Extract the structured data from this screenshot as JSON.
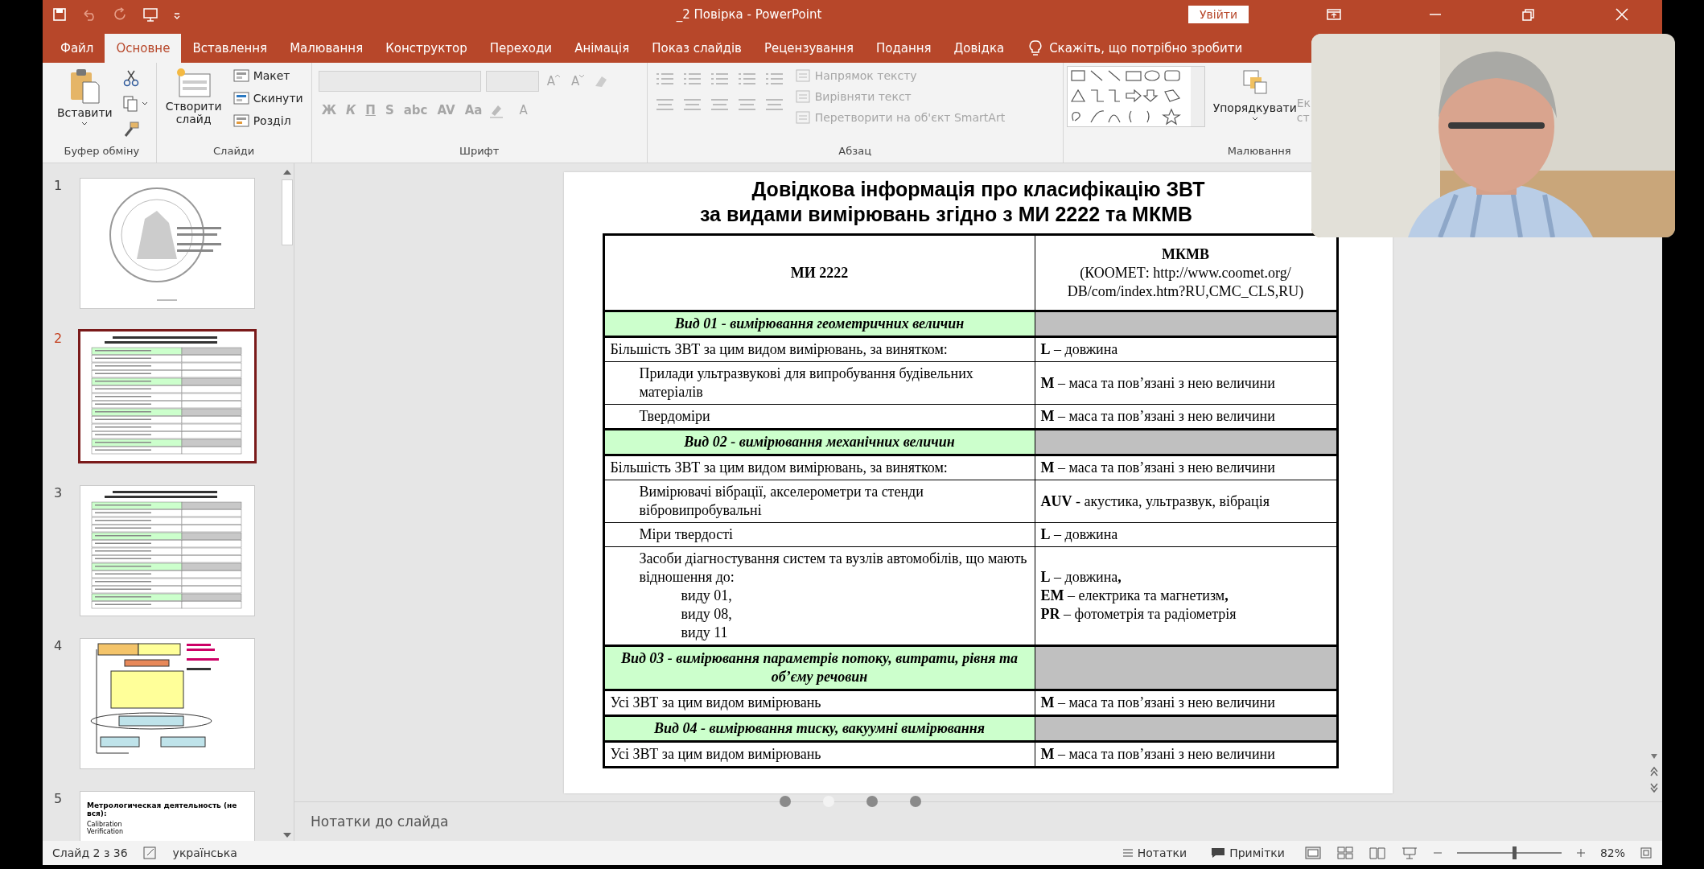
{
  "window": {
    "title": "_2 Повірка  -  PowerPoint",
    "sign_in": "Увійти"
  },
  "ribbon_tabs": [
    {
      "label": "Файл",
      "selected": false
    },
    {
      "label": "Основне",
      "selected": true
    },
    {
      "label": "Вставлення",
      "selected": false
    },
    {
      "label": "Малювання",
      "selected": false
    },
    {
      "label": "Конструктор",
      "selected": false
    },
    {
      "label": "Переходи",
      "selected": false
    },
    {
      "label": "Анімація",
      "selected": false
    },
    {
      "label": "Показ слайдів",
      "selected": false
    },
    {
      "label": "Рецензування",
      "selected": false
    },
    {
      "label": "Подання",
      "selected": false
    },
    {
      "label": "Довідка",
      "selected": false
    }
  ],
  "tell_me": "Скажіть, що потрібно зробити",
  "clipboard": {
    "paste": "Вставити",
    "label": "Буфер обміну"
  },
  "slides_group": {
    "new_slide": "Створити слайд",
    "items": [
      "Макет",
      "Скинути",
      "Розділ"
    ],
    "label": "Слайди"
  },
  "font": {
    "disabled": true,
    "row1": [
      {
        "kind": "grow",
        "text": "A"
      },
      {
        "kind": "shrink",
        "text": "A"
      }
    ],
    "row2": [
      "Ж",
      "К",
      "П",
      "S",
      "abc",
      "AV",
      "Aa"
    ],
    "color_button": "A",
    "label": "Шрифт"
  },
  "paragraph": {
    "commands": [
      {
        "label": "Напрямок тексту",
        "disabled": true
      },
      {
        "label": "Вирівняти текст",
        "disabled": true
      },
      {
        "label": "Перетворити на об'єкт SmartArt",
        "disabled": true
      }
    ],
    "label": "Абзац"
  },
  "drawing": {
    "arrange": "Упорядкувати",
    "quick_styles": [
      "Ек",
      "ст"
    ],
    "label": "Малювання"
  },
  "thumbnails": [
    {
      "number": "1",
      "selected": false,
      "kind": "seal"
    },
    {
      "number": "2",
      "selected": true,
      "kind": "table"
    },
    {
      "number": "3",
      "selected": false,
      "kind": "table"
    },
    {
      "number": "4",
      "selected": false,
      "kind": "diagram"
    },
    {
      "number": "5",
      "selected": false,
      "kind": "list",
      "title": "Метрологическая деятельность (не вся):",
      "lines": [
        "Calibration",
        "Verification"
      ]
    }
  ],
  "slide": {
    "title": [
      "Довідкова інформація про класифікацію ЗВТ",
      "за видами вимірювань згідно з МИ 2222 та МКМВ"
    ],
    "header": {
      "left": "МИ 2222",
      "right": [
        "МКМВ",
        "(КООМЕТ: http://www.coomet.org/",
        "DB/com/index.htm?RU,CMC_CLS,RU)"
      ]
    },
    "rows": [
      {
        "kind": "section",
        "text": "Вид 01 - вимірювання геометричних величин"
      },
      {
        "kind": "row",
        "left": [
          "Більшість ЗВТ за цим видом вимірювань, за винятком:"
        ],
        "right": [
          "**L** – довжина"
        ],
        "children": [
          {
            "kind": "row",
            "left": [
              "Прилади ультразвукові для випробування будівельних матеріалів"
            ],
            "right": [
              "**M** – маса та пов’язані з нею величини"
            ]
          },
          {
            "kind": "row",
            "left": [
              "Твердоміри"
            ],
            "right": [
              "**M** – маса та пов’язані з нею величини"
            ]
          }
        ]
      },
      {
        "kind": "section",
        "text": "Вид 02 - вимірювання механічних величин"
      },
      {
        "kind": "row",
        "left": [
          "Більшість ЗВТ за цим видом вимірювань, за винятком:"
        ],
        "right": [
          "**M** – маса та пов’язані з нею величини"
        ],
        "children": [
          {
            "kind": "row",
            "left": [
              "Вимірювачі вібрації, акселерометри та стенди вібровипробувальні"
            ],
            "right": [
              "**AUV** - акустика, ультразвук, вібрація"
            ]
          },
          {
            "kind": "row",
            "left": [
              "Міри твердості"
            ],
            "right": [
              "**L** – довжина"
            ]
          },
          {
            "kind": "row",
            "left": [
              "Засоби діагностування систем та вузлів автомобілів, що мають відношення до:"
            ],
            "sublines": [
              "виду 01,",
              "виду 08,",
              "виду 11"
            ],
            "right": [
              "**L** – довжина**,**",
              "**EM** – електрика та магнетизм**,**",
              "**PR** – фотометрія та радіометрія"
            ]
          }
        ]
      },
      {
        "kind": "section",
        "text": "Вид 03 - вимірювання параметрів потоку, витрати, рівня та об’єму речовин"
      },
      {
        "kind": "row",
        "left": [
          "Усі ЗВТ за цим видом вимірювань"
        ],
        "right": [
          "**M** – маса та пов’язані з нею величини"
        ]
      },
      {
        "kind": "section",
        "text": "Вид 04 - вимірювання тиску, вакуумні вимірювання"
      },
      {
        "kind": "row",
        "left": [
          "Усі ЗВТ за цим видом вимірювань"
        ],
        "right": [
          "**M** – маса та пов’язані з нею величини"
        ]
      }
    ]
  },
  "notes_placeholder": "Нотатки до слайда",
  "pager": [
    {
      "selected": false
    },
    {
      "selected": true
    },
    {
      "selected": false
    },
    {
      "selected": false
    }
  ],
  "status_bar": {
    "slide": "Слайд 2 з 36",
    "language": "українська",
    "notes": "Нотатки",
    "comments": "Примітки",
    "zoom": "82%",
    "zoom_slider": {
      "level": 0.53
    }
  }
}
